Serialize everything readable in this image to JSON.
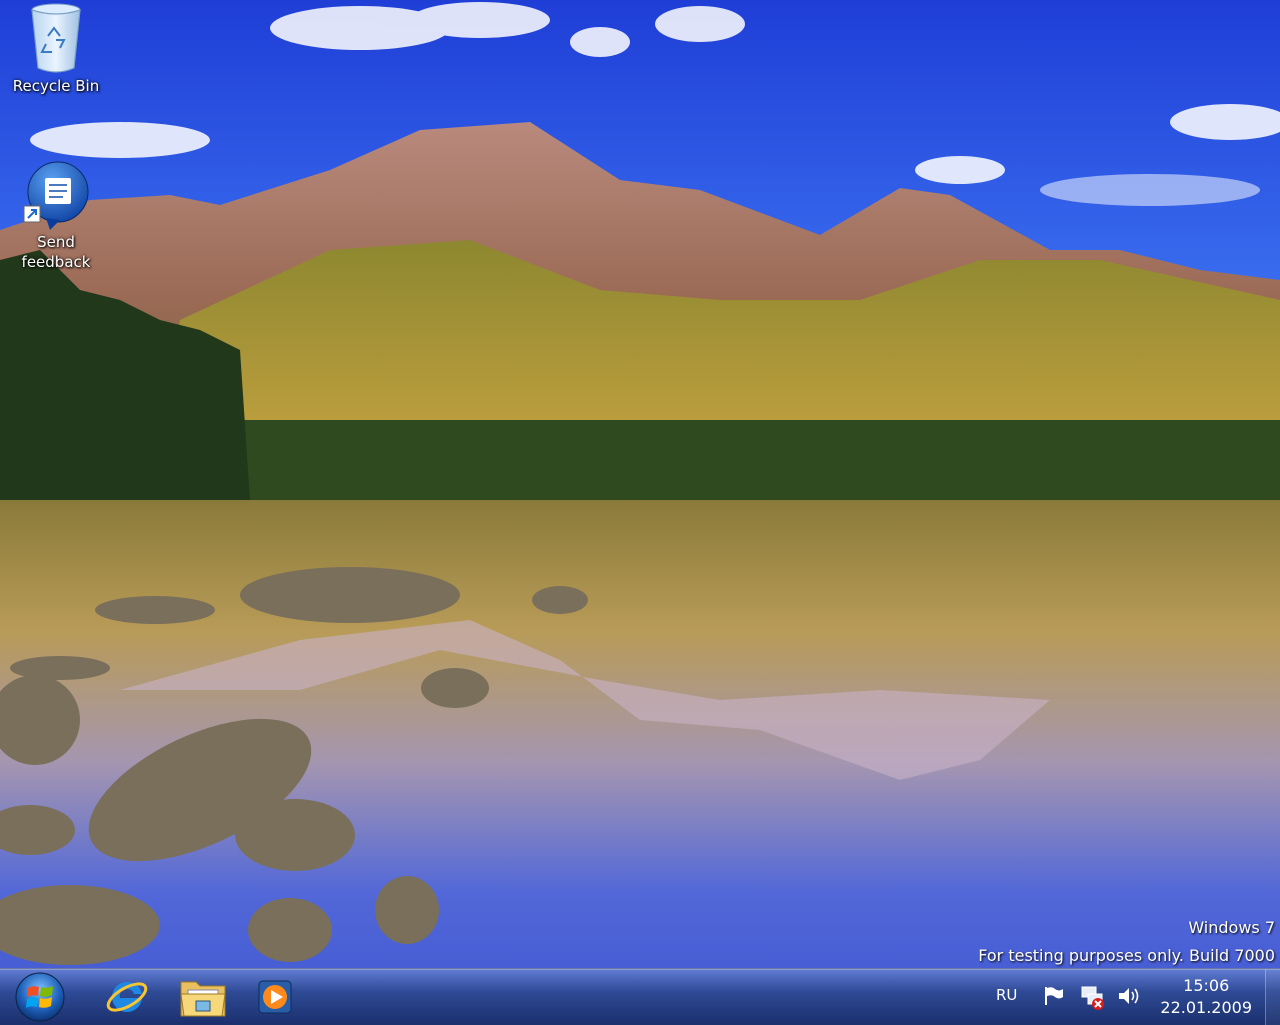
{
  "desktop": {
    "icons": [
      {
        "label": "Recycle Bin",
        "icon": "recycle-bin-icon"
      },
      {
        "label": "Send feedback",
        "icon": "send-feedback-icon"
      }
    ]
  },
  "watermark": {
    "line1": "Windows  7",
    "line2": "For testing purposes only. Build 7000"
  },
  "taskbar": {
    "pinned": [
      {
        "name": "internet-explorer",
        "icon": "internet-explorer-icon"
      },
      {
        "name": "windows-explorer",
        "icon": "folder-icon"
      },
      {
        "name": "windows-media-player",
        "icon": "media-player-icon"
      }
    ],
    "tray": {
      "language": "RU",
      "time": "15:06",
      "date": "22.01.2009"
    }
  },
  "colors": {
    "sky": "#2c50d8",
    "taskbar": "#1c3466",
    "accent": "#3a8ee6"
  }
}
